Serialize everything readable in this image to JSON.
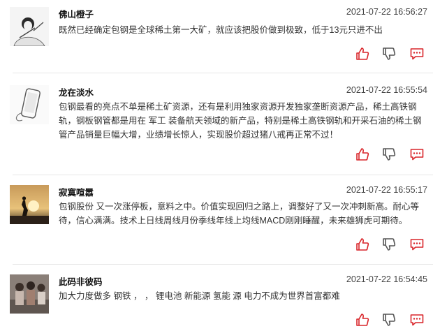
{
  "colors": {
    "action_red": "#d9252a",
    "divider": "#e6e6e6",
    "text": "#333333"
  },
  "icons": {
    "like": "thumbs-up-icon",
    "dislike": "thumbs-down-icon",
    "reply": "comment-bubble-icon"
  },
  "comments": [
    {
      "username": "佛山橙子",
      "timestamp": "2021-07-22 16:56:27",
      "content": "既然已经确定包钢是全球稀土第一大矿，就应该把股价做到极致，低于13元只进不出",
      "avatar": "sketch-portrait-avatar"
    },
    {
      "username": "龙在淡水",
      "timestamp": "2021-07-22 16:55:54",
      "content": "包钢最看的亮点不单是稀土矿资源，还有是利用独家资源开发独家垄断资源产品，稀土高铁钢轨，钢板钢管都是用在 军工 装备航天领域的新产品，特别是稀土高铁钢轨和开采石油的稀土钢管产品销量巨幅大增，业绩增长惊人，实现股价超过猪八戒再正常不过！",
      "avatar": "phone-sketch-avatar"
    },
    {
      "username": "寂寞喧嚣",
      "timestamp": "2021-07-22 16:55:17",
      "content": "包钢股份 又一次涨停板，意料之中。价值实现回归之路上，调整好了又一次冲刺新高。耐心等待，信心满满。技术上日线周线月份季线年线上均线MACD刚刚睡醒，未来雄狮虎可期待。",
      "avatar": "sunset-silhouette-avatar"
    },
    {
      "username": "此码非彼码",
      "timestamp": "2021-07-22 16:54:45",
      "content": "加大力度做多 钢铁 ， ， 锂电池 新能源 氢能 源 电力不成为世界首富都难",
      "avatar": "group-photo-avatar"
    }
  ]
}
